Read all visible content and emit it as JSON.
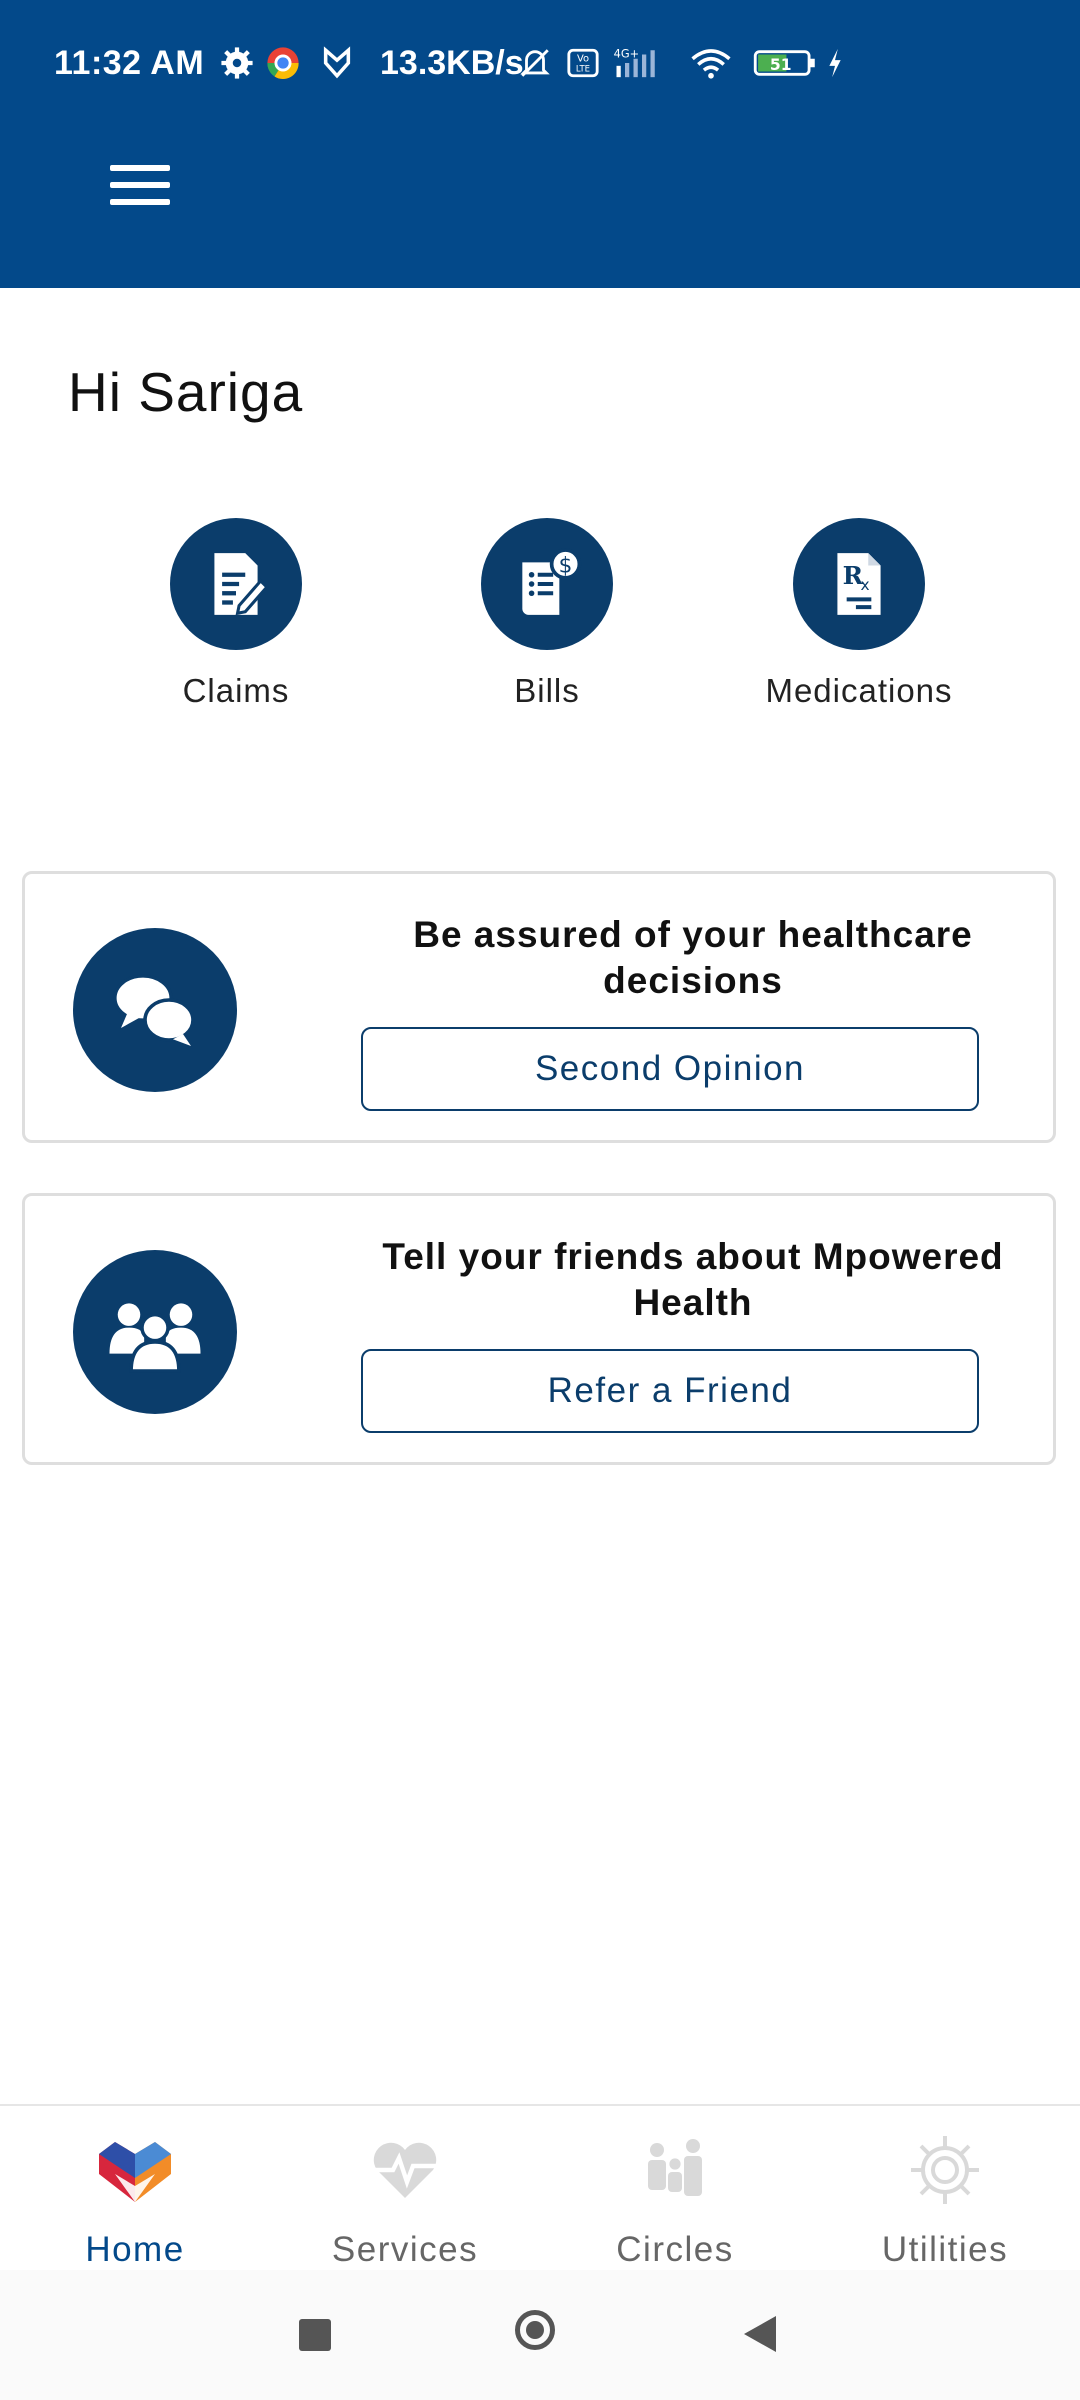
{
  "status_bar": {
    "time": "11:32 AM",
    "network_speed": "13.3KB/s",
    "battery": "51",
    "icons": [
      "gear-icon",
      "chrome-icon",
      "shield-icon",
      "mute-icon",
      "volte-icon",
      "signal-4g-icon",
      "wifi-icon",
      "battery-icon",
      "charging-icon"
    ]
  },
  "header": {
    "menu_icon": "hamburger-menu-icon",
    "color": "#03498A"
  },
  "greeting": "Hi Sariga",
  "shortcuts": [
    {
      "label": "Claims",
      "icon": "claims-document-icon"
    },
    {
      "label": "Bills",
      "icon": "bill-dollar-icon"
    },
    {
      "label": "Medications",
      "icon": "prescription-icon"
    }
  ],
  "cards": [
    {
      "title": "Be assured of your healthcare decisions",
      "button": "Second Opinion",
      "icon": "chat-bubbles-icon"
    },
    {
      "title": "Tell your friends about Mpowered Health",
      "button": "Refer a Friend",
      "icon": "group-people-icon"
    }
  ],
  "bottom_nav": [
    {
      "label": "Home",
      "icon": "home-logo-icon",
      "active": true
    },
    {
      "label": "Services",
      "icon": "heartbeat-icon",
      "active": false
    },
    {
      "label": "Circles",
      "icon": "family-icon",
      "active": false
    },
    {
      "label": "Utilities",
      "icon": "settings-gear-icon",
      "active": false
    }
  ],
  "system_nav": [
    "recent-apps-icon",
    "home-circle-icon",
    "back-triangle-icon"
  ],
  "colors": {
    "primary": "#03498A",
    "icon_circle": "#0B3D6B",
    "card_border": "#DEDEDE"
  }
}
